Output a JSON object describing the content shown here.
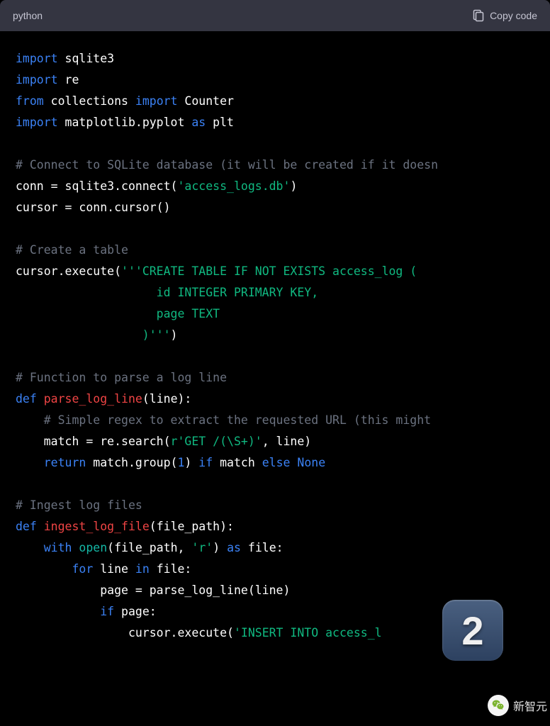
{
  "header": {
    "language": "python",
    "copy_label": "Copy code"
  },
  "code": {
    "line1_import": "import",
    "line1_mod": " sqlite3",
    "line2_import": "import",
    "line2_mod": " re",
    "line3_from": "from",
    "line3_mod": " collections ",
    "line3_import": "import",
    "line3_name": " Counter",
    "line4_import": "import",
    "line4_mod": " matplotlib.pyplot ",
    "line4_as": "as",
    "line4_alias": " plt",
    "comment1": "# Connect to SQLite database (it will be created if it doesn",
    "line6_a": "conn = sqlite3.connect(",
    "line6_str": "'access_logs.db'",
    "line6_b": ")",
    "line7": "cursor = conn.cursor()",
    "comment2": "# Create a table",
    "line9_a": "cursor.execute(",
    "line9_str": "'''CREATE TABLE IF NOT EXISTS access_log (",
    "line10_str": "                    id INTEGER PRIMARY KEY,",
    "line11_str": "                    page TEXT",
    "line12_str": "                  )'''",
    "line12_b": ")",
    "comment3": "# Function to parse a log line",
    "line14_def": "def",
    "line14_fn": " parse_log_line",
    "line14_args": "(line):",
    "comment4": "    # Simple regex to extract the requested URL (this might ",
    "line16_a": "    match = re.search(",
    "line16_str": "r'GET /(\\S+)'",
    "line16_b": ", line)",
    "line17_ret": "    return",
    "line17_a": " match.group(",
    "line17_num": "1",
    "line17_b": ") ",
    "line17_if": "if",
    "line17_c": " match ",
    "line17_else": "else",
    "line17_d": " ",
    "line17_none": "None",
    "comment5": "# Ingest log files",
    "line19_def": "def",
    "line19_fn": " ingest_log_file",
    "line19_args": "(file_path):",
    "line20_with": "    with",
    "line20_a": " ",
    "line20_open": "open",
    "line20_b": "(file_path, ",
    "line20_str": "'r'",
    "line20_c": ") ",
    "line20_as": "as",
    "line20_d": " file:",
    "line21_for": "        for",
    "line21_a": " line ",
    "line21_in": "in",
    "line21_b": " file:",
    "line22": "            page = parse_log_line(line)",
    "line23_if": "            if",
    "line23_a": " page:",
    "line24_a": "                cursor.execute(",
    "line24_str": "'INSERT INTO access_l"
  },
  "badge": {
    "number": "2"
  },
  "overlay": {
    "source_text": "新智元"
  }
}
